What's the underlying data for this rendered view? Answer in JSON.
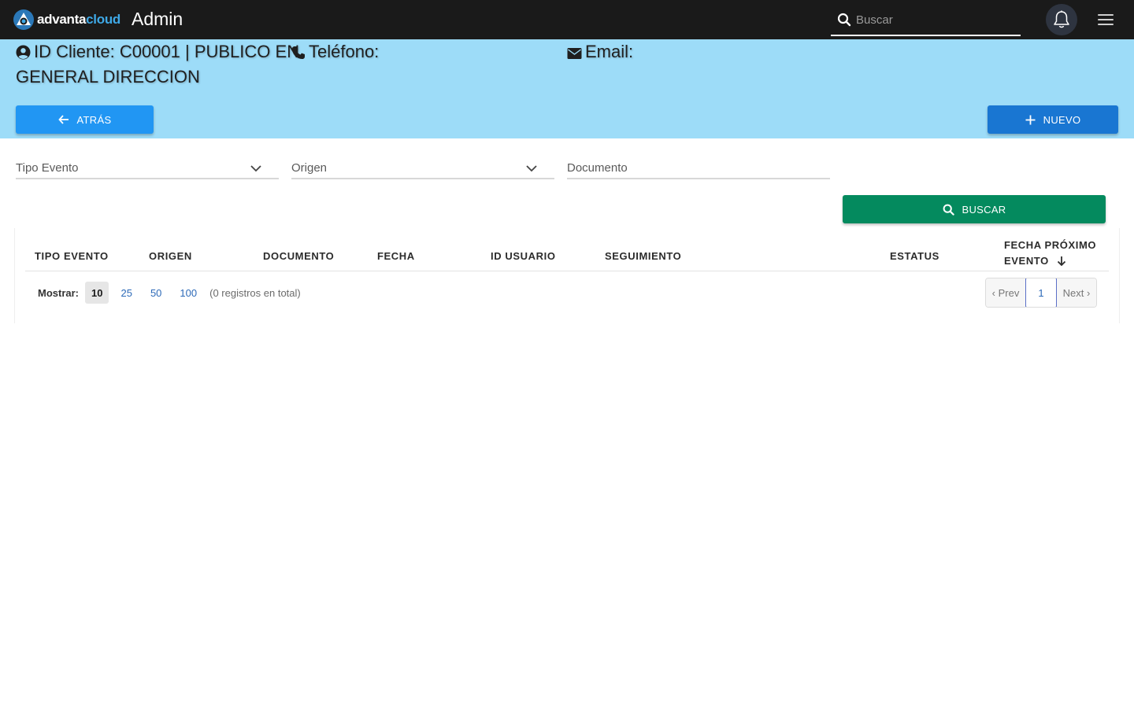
{
  "topbar": {
    "logo_text_a": "advanta",
    "logo_text_b": "cloud",
    "app_title": "Admin",
    "search_placeholder": "Buscar",
    "icons": [
      "logo-icon",
      "search-icon",
      "bell-icon",
      "hamburger-menu-icon"
    ]
  },
  "client": {
    "id_line_1": "ID Cliente: C00001 | PUBLICO EN",
    "id_line_2": "GENERAL DIRECCION",
    "phone_label": "Teléfono:",
    "email_label": "Email:"
  },
  "actions": {
    "back_label": "ATRÁS",
    "new_label": "NUEVO",
    "search_label": "BUSCAR"
  },
  "filters": {
    "tipo_evento": "Tipo Evento",
    "origen": "Origen",
    "documento": "Documento"
  },
  "table": {
    "columns": [
      "TIPO EVENTO",
      "ORIGEN",
      "DOCUMENTO",
      "FECHA",
      "ID USUARIO",
      "SEGUIMIENTO",
      "ESTATUS",
      "FECHA PRÓXIMO",
      "EVENTO"
    ],
    "rows": []
  },
  "pagination": {
    "show_label": "Mostrar:",
    "sizes": [
      "10",
      "25",
      "50",
      "100"
    ],
    "selected_size": "10",
    "total_text": "(0 registros en total)",
    "prev_label": "‹ Prev",
    "current_page": "1",
    "next_label": "Next ›"
  },
  "colors": {
    "topbar": "#1a1a1a",
    "header_bg": "#9ddcf8",
    "back_button": "#2196f3",
    "new_button": "#1976d2",
    "search_button": "#048a5e",
    "link": "#2d6ab8"
  }
}
